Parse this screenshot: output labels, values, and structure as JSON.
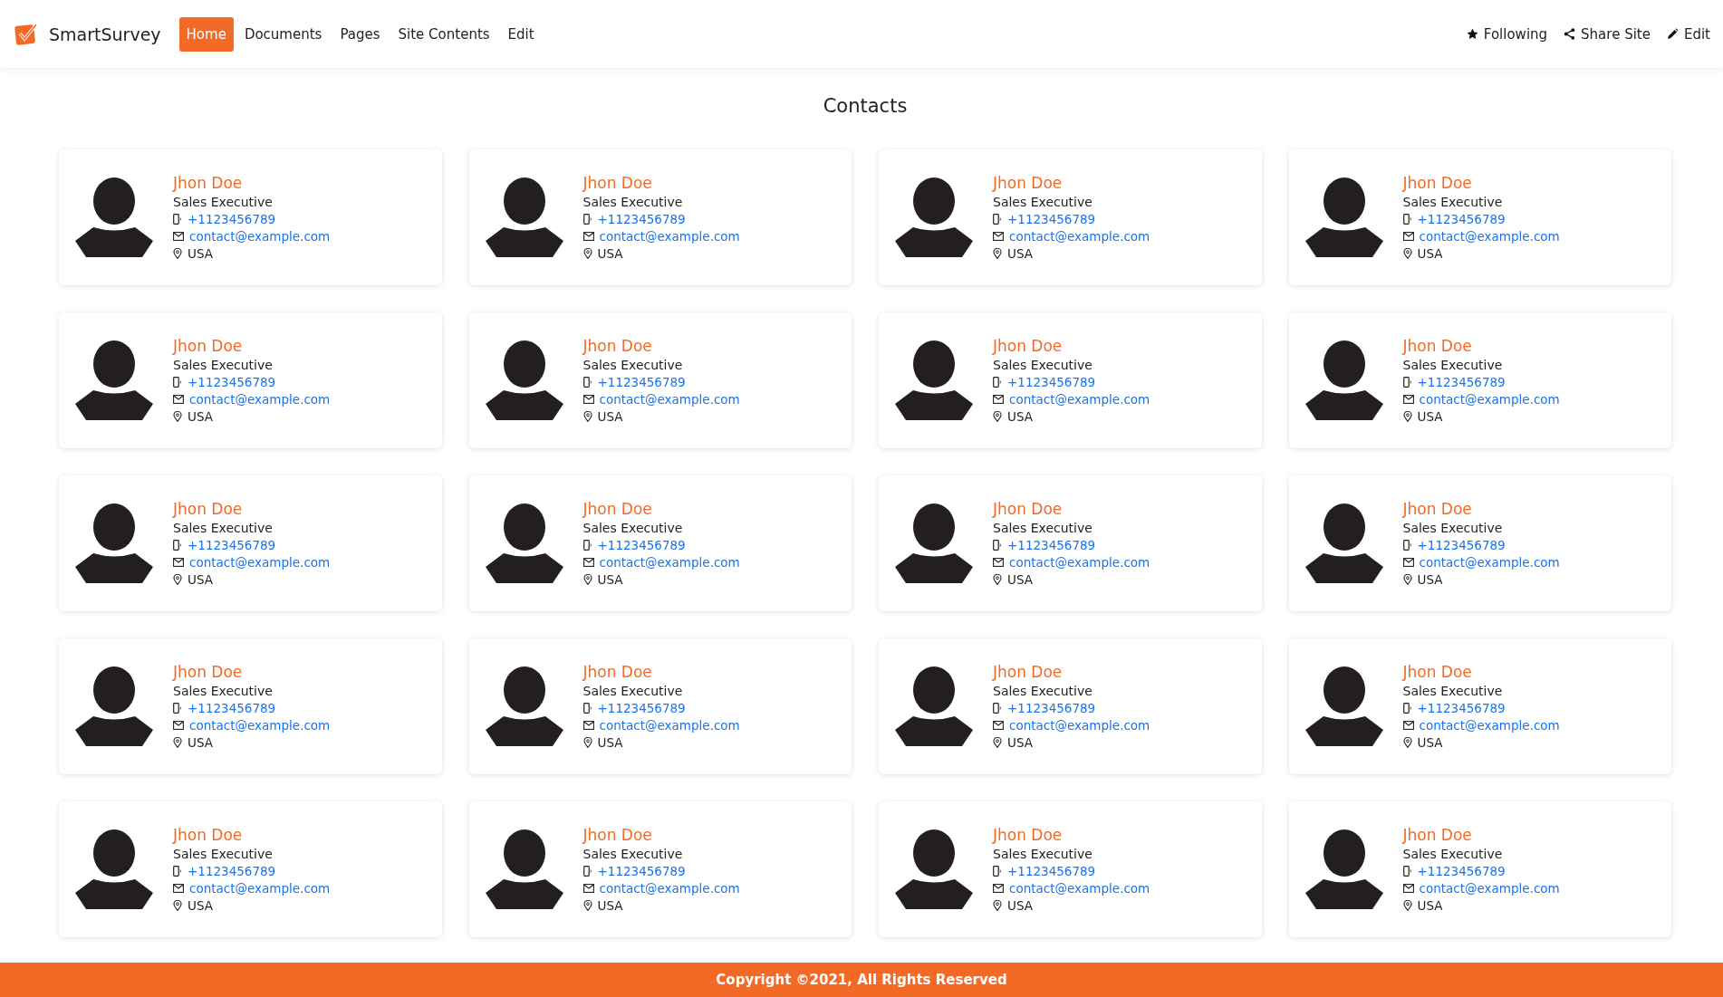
{
  "brand": "SmartSurvey",
  "nav": [
    {
      "label": "Home",
      "selected": true
    },
    {
      "label": "Documents",
      "selected": false
    },
    {
      "label": "Pages",
      "selected": false
    },
    {
      "label": "Site Contents",
      "selected": false
    },
    {
      "label": "Edit",
      "selected": false
    }
  ],
  "actions": [
    {
      "kind": "star",
      "label": "Following"
    },
    {
      "kind": "share",
      "label": "Share Site"
    },
    {
      "kind": "pencil",
      "label": "Edit"
    }
  ],
  "title": "Contacts",
  "contacts": [
    {
      "name": "Jhon Doe",
      "role": "Sales Executive",
      "phone": "+1123456789",
      "email": "contact@example.com",
      "location": "USA"
    },
    {
      "name": "Jhon Doe",
      "role": "Sales Executive",
      "phone": "+1123456789",
      "email": "contact@example.com",
      "location": "USA"
    },
    {
      "name": "Jhon Doe",
      "role": "Sales Executive",
      "phone": "+1123456789",
      "email": "contact@example.com",
      "location": "USA"
    },
    {
      "name": "Jhon Doe",
      "role": "Sales Executive",
      "phone": "+1123456789",
      "email": "contact@example.com",
      "location": "USA"
    },
    {
      "name": "Jhon Doe",
      "role": "Sales Executive",
      "phone": "+1123456789",
      "email": "contact@example.com",
      "location": "USA"
    },
    {
      "name": "Jhon Doe",
      "role": "Sales Executive",
      "phone": "+1123456789",
      "email": "contact@example.com",
      "location": "USA"
    },
    {
      "name": "Jhon Doe",
      "role": "Sales Executive",
      "phone": "+1123456789",
      "email": "contact@example.com",
      "location": "USA"
    },
    {
      "name": "Jhon Doe",
      "role": "Sales Executive",
      "phone": "+1123456789",
      "email": "contact@example.com",
      "location": "USA"
    },
    {
      "name": "Jhon Doe",
      "role": "Sales Executive",
      "phone": "+1123456789",
      "email": "contact@example.com",
      "location": "USA"
    },
    {
      "name": "Jhon Doe",
      "role": "Sales Executive",
      "phone": "+1123456789",
      "email": "contact@example.com",
      "location": "USA"
    },
    {
      "name": "Jhon Doe",
      "role": "Sales Executive",
      "phone": "+1123456789",
      "email": "contact@example.com",
      "location": "USA"
    },
    {
      "name": "Jhon Doe",
      "role": "Sales Executive",
      "phone": "+1123456789",
      "email": "contact@example.com",
      "location": "USA"
    },
    {
      "name": "Jhon Doe",
      "role": "Sales Executive",
      "phone": "+1123456789",
      "email": "contact@example.com",
      "location": "USA"
    },
    {
      "name": "Jhon Doe",
      "role": "Sales Executive",
      "phone": "+1123456789",
      "email": "contact@example.com",
      "location": "USA"
    },
    {
      "name": "Jhon Doe",
      "role": "Sales Executive",
      "phone": "+1123456789",
      "email": "contact@example.com",
      "location": "USA"
    },
    {
      "name": "Jhon Doe",
      "role": "Sales Executive",
      "phone": "+1123456789",
      "email": "contact@example.com",
      "location": "USA"
    },
    {
      "name": "Jhon Doe",
      "role": "Sales Executive",
      "phone": "+1123456789",
      "email": "contact@example.com",
      "location": "USA"
    },
    {
      "name": "Jhon Doe",
      "role": "Sales Executive",
      "phone": "+1123456789",
      "email": "contact@example.com",
      "location": "USA"
    },
    {
      "name": "Jhon Doe",
      "role": "Sales Executive",
      "phone": "+1123456789",
      "email": "contact@example.com",
      "location": "USA"
    },
    {
      "name": "Jhon Doe",
      "role": "Sales Executive",
      "phone": "+1123456789",
      "email": "contact@example.com",
      "location": "USA"
    }
  ],
  "footer": "Copyright ©2021, All Rights Reserved"
}
